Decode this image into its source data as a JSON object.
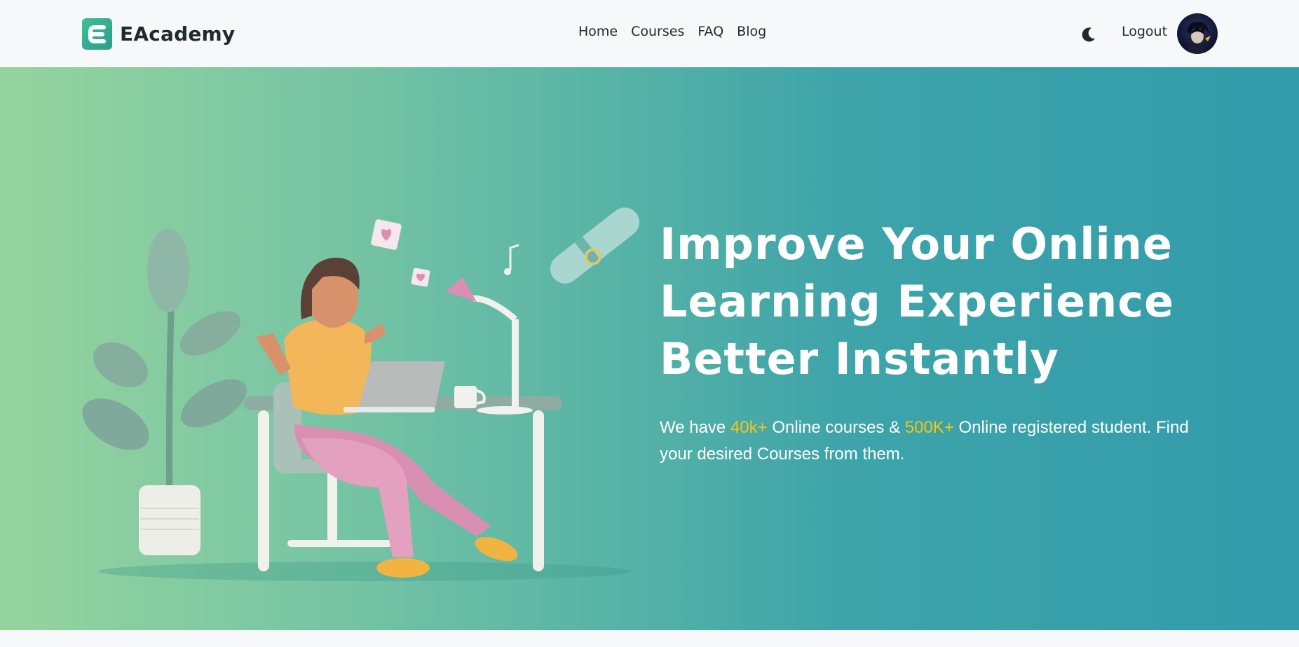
{
  "brand": {
    "name": "EAcademy",
    "logo_letter": "E",
    "icon": "eacademy-logo-icon",
    "accent": "#2fae8f"
  },
  "nav": {
    "links": [
      {
        "label": "Home"
      },
      {
        "label": "Courses"
      },
      {
        "label": "FAQ"
      },
      {
        "label": "Blog"
      }
    ],
    "theme_toggle_icon": "moon-icon",
    "logout_label": "Logout",
    "avatar_icon": "user-avatar"
  },
  "hero": {
    "headline_lines": [
      "Improve Your Online",
      "Learning Experience",
      "Better Instantly"
    ],
    "sub_prefix": "We have ",
    "stat_courses": "40k+",
    "sub_mid": " Online courses & ",
    "stat_students": "500K+",
    "sub_suffix": " Online registered student. Find your desired Courses from them.",
    "highlight_color": "#f5c518",
    "gradient_start": "#95d49e",
    "gradient_end": "#329cab"
  }
}
